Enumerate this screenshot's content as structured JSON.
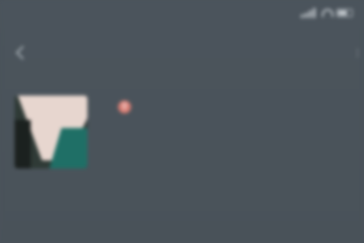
{
  "status_bar": {
    "time": "",
    "carrier_text": "",
    "icons": [
      "signal-icon",
      "wifi-icon",
      "battery-icon"
    ]
  },
  "nav": {
    "back_icon": "back-icon",
    "more_icon": "more-icon"
  },
  "profile": {
    "name": "",
    "gender_badge_icon": "female-icon",
    "id_line": "",
    "region_line": ""
  },
  "colors": {
    "background": "#4a535b",
    "badge": "#d97d73",
    "avatar_teal": "#1f6f66"
  }
}
